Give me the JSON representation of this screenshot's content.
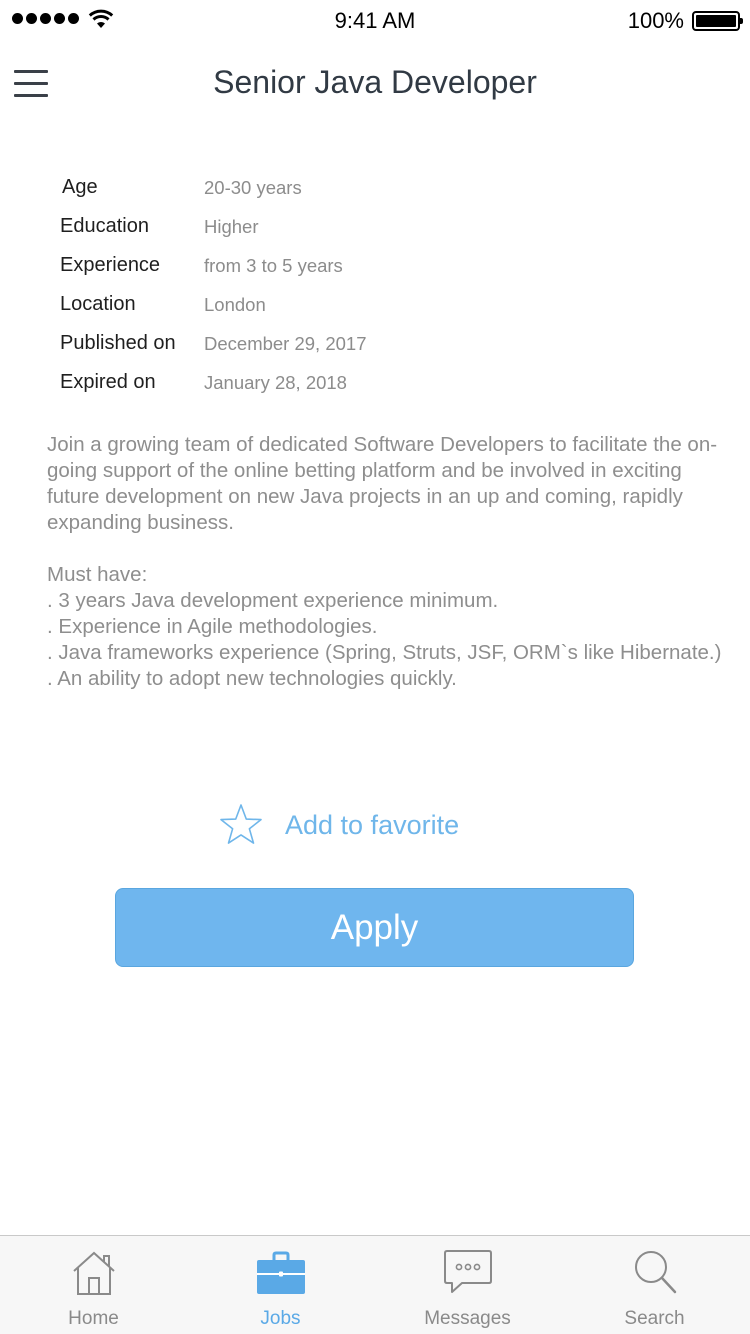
{
  "status_bar": {
    "time": "9:41 AM",
    "battery_percent": "100%",
    "signal_bars": 5,
    "icons": [
      "signal-dots-icon",
      "wifi-icon",
      "battery-icon"
    ]
  },
  "nav_bar": {
    "title": "Senior Java Developer",
    "menu_icon": "hamburger-menu-icon"
  },
  "details": [
    {
      "label": "Age",
      "value": "20-30 years"
    },
    {
      "label": "Education",
      "value": "Higher"
    },
    {
      "label": "Experience",
      "value": "from 3 to 5 years"
    },
    {
      "label": "Location",
      "value": "London"
    },
    {
      "label": "Published on",
      "value": "December 29, 2017"
    },
    {
      "label": "Expired on",
      "value": "January 28, 2018"
    }
  ],
  "description": {
    "intro": "Join a growing team of dedicated Software Developers to facilitate the on-going support of the online betting platform and be involved in exciting future development on new Java projects in an up and coming, rapidly expanding business.",
    "requirements_heading": "Must have:",
    "requirements": [
      ". 3 years Java development experience minimum.",
      ". Experience in Agile methodologies.",
      ". Java frameworks experience (Spring, Struts, JSF, ORM`s like Hibernate.)",
      ". An ability to adopt new technologies quickly."
    ]
  },
  "favorite": {
    "label": "Add to favorite",
    "icon": "star-outline-icon"
  },
  "apply": {
    "label": "Apply"
  },
  "tab_bar": {
    "tabs": [
      {
        "label": "Home",
        "icon": "home-icon",
        "active": false
      },
      {
        "label": "Jobs",
        "icon": "briefcase-icon",
        "active": true
      },
      {
        "label": "Messages",
        "icon": "message-bubble-icon",
        "active": false
      },
      {
        "label": "Search",
        "icon": "magnifier-icon",
        "active": false
      }
    ]
  },
  "colors": {
    "accent": "#6fb6ee",
    "accent_text": "#5aa9e6",
    "title_text": "#313a44",
    "muted_text": "#8e8e8e",
    "tab_bar_bg": "#f7f7f7"
  }
}
